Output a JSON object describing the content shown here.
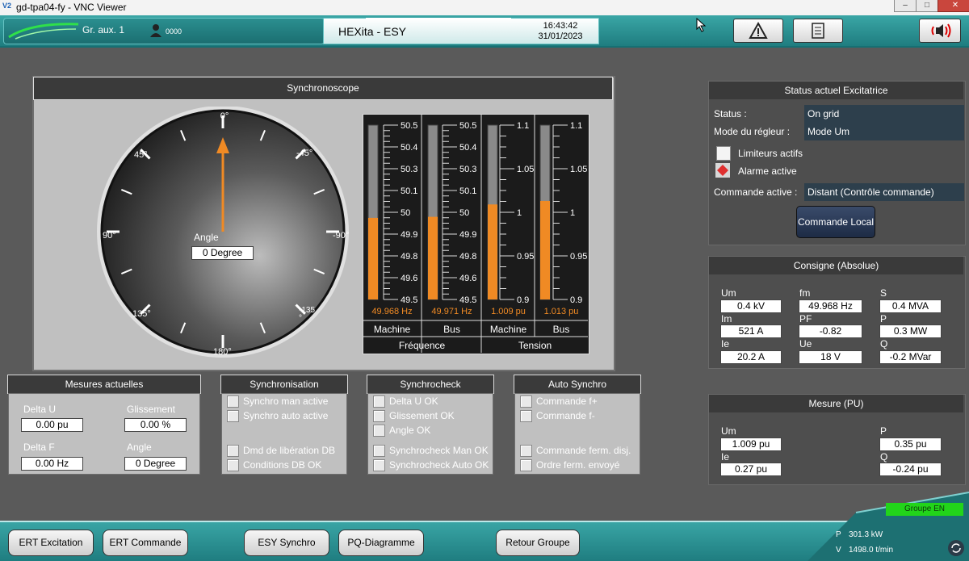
{
  "window": {
    "title": "gd-tpa04-fy - VNC Viewer",
    "logo": "V2"
  },
  "header": {
    "group_label": "Gr. aux. 1",
    "user_code": "0000",
    "app_title": "HEXita - ESY",
    "time": "16:43:42",
    "date": "31/01/2023",
    "icons": [
      "warning-icon",
      "list-icon",
      "speaker-icon"
    ]
  },
  "synchroscope": {
    "title": "Synchronoscope",
    "angle_label": "Angle",
    "angle_value": "0 Degree",
    "angle_deg": 0,
    "dial_labels": {
      "top": "0°",
      "tl": "45°",
      "tr": "-45°",
      "left": "90°",
      "right": "-90°",
      "bl": "135°",
      "br": "-135 °",
      "bottom": "180°"
    }
  },
  "bars": {
    "freq_ticks": [
      "50.5",
      "50.4",
      "50.3",
      "50.1",
      "50",
      "49.9",
      "49.8",
      "49.6",
      "49.5"
    ],
    "volt_ticks": [
      "1.1",
      "1.05",
      "1",
      "0.95",
      "0.9"
    ],
    "machine_freq": {
      "value_text": "49.968 Hz",
      "fill": 0.468
    },
    "bus_freq": {
      "value_text": "49.971 Hz",
      "fill": 0.474
    },
    "machine_volt": {
      "value_text": "1.009 pu",
      "fill": 0.545
    },
    "bus_volt": {
      "value_text": "1.013 pu",
      "fill": 0.565
    },
    "labels": {
      "machine": "Machine",
      "bus": "Bus",
      "frequence": "Fréquence",
      "tension": "Tension"
    }
  },
  "status": {
    "title": "Status actuel Excitatrice",
    "status_label": "Status :",
    "status_value": "On grid",
    "mode_label": "Mode du régleur :",
    "mode_value": "Mode Um",
    "limiteurs": "Limiteurs actifs",
    "alarme": "Alarme active",
    "commande_label": "Commande active :",
    "commande_value": "Distant (Contrôle commande)",
    "commande_button": "Commande Local"
  },
  "consigne": {
    "title": "Consigne (Absolue)",
    "fields": [
      {
        "label": "Um",
        "value": "0.4 kV"
      },
      {
        "label": "fm",
        "value": "49.968 Hz"
      },
      {
        "label": "S",
        "value": "0.4 MVA"
      },
      {
        "label": "Im",
        "value": "521 A"
      },
      {
        "label": "PF",
        "value": "-0.82"
      },
      {
        "label": "P",
        "value": "0.3 MW"
      },
      {
        "label": "Ie",
        "value": "20.2 A"
      },
      {
        "label": "Ue",
        "value": "18 V"
      },
      {
        "label": "Q",
        "value": "-0.2 MVar"
      }
    ]
  },
  "mesure_pu": {
    "title": "Mesure (PU)",
    "um_label": "Um",
    "um_value": "1.009 pu",
    "p_label": "P",
    "p_value": "0.35 pu",
    "ie_label": "Ie",
    "ie_value": "0.27 pu",
    "q_label": "Q",
    "q_value": "-0.24 pu"
  },
  "mesures": {
    "title": "Mesures actuelles",
    "delta_u_label": "Delta U",
    "delta_u_value": "0.00 pu",
    "glissement_label": "Glissement",
    "glissement_value": "0.00 %",
    "delta_f_label": "Delta F",
    "delta_f_value": "0.00 Hz",
    "angle_label": "Angle",
    "angle_value": "0 Degree"
  },
  "synchronisation": {
    "title": "Synchronisation",
    "items": [
      "Synchro man active",
      "Synchro auto active",
      "Dmd de libération DB",
      "Conditions DB OK"
    ]
  },
  "synchrocheck": {
    "title": "Synchrocheck",
    "items": [
      "Delta U OK",
      "Glissement OK",
      "Angle OK",
      "Synchrocheck Man OK",
      "Synchrocheck Auto OK"
    ]
  },
  "auto_synchro": {
    "title": "Auto Synchro",
    "items": [
      "Commande f+",
      "Commande f-",
      "Commande ferm. disj.",
      "Ordre ferm. envoyé"
    ]
  },
  "footer": {
    "buttons": [
      "ERT Excitation",
      "ERT Commande",
      "ESY Synchro",
      "PQ-Diagramme",
      "Retour Groupe"
    ],
    "groupe_badge": "Groupe EN",
    "p_label": "P",
    "p_value": "301.3 kW",
    "v_label": "V",
    "v_value": "1498.0 t/min"
  },
  "colors": {
    "accent": "#f08a24",
    "teal": "#2b9597",
    "status_green": "#22d41a",
    "alarm_red": "#e03030"
  }
}
